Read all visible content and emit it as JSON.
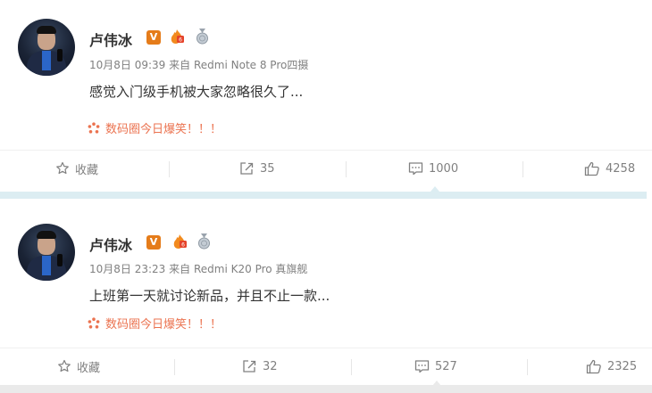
{
  "posts": [
    {
      "author": "卢伟冰",
      "verified_badge": "V",
      "time": "10月8日 09:39",
      "from_label": "来自",
      "device": "Redmi Note 8 Pro四摄",
      "content": "感觉入门级手机被大家忽略很久了...",
      "topic": "数码圈今日爆笑！！！",
      "actions": {
        "favorite_label": "收藏",
        "forward_count": "35",
        "comment_count": "1000",
        "like_count": "4258"
      }
    },
    {
      "author": "卢伟冰",
      "verified_badge": "V",
      "time": "10月8日 23:23",
      "from_label": "来自",
      "device": "Redmi K20 Pro 真旗舰",
      "content": "上班第一天就讨论新品，并且不止一款...",
      "topic": "数码圈今日爆笑！！！",
      "actions": {
        "favorite_label": "收藏",
        "forward_count": "32",
        "comment_count": "527",
        "like_count": "2325"
      }
    }
  ],
  "colors": {
    "topic": "#eb7350",
    "meta": "#808080",
    "verified": "#e57c1a",
    "divider": "#dcedf2"
  },
  "icons": [
    "star-icon",
    "forward-icon",
    "comment-icon",
    "like-icon",
    "topic-dots-icon",
    "flame-badge-icon",
    "medal-badge-icon"
  ]
}
